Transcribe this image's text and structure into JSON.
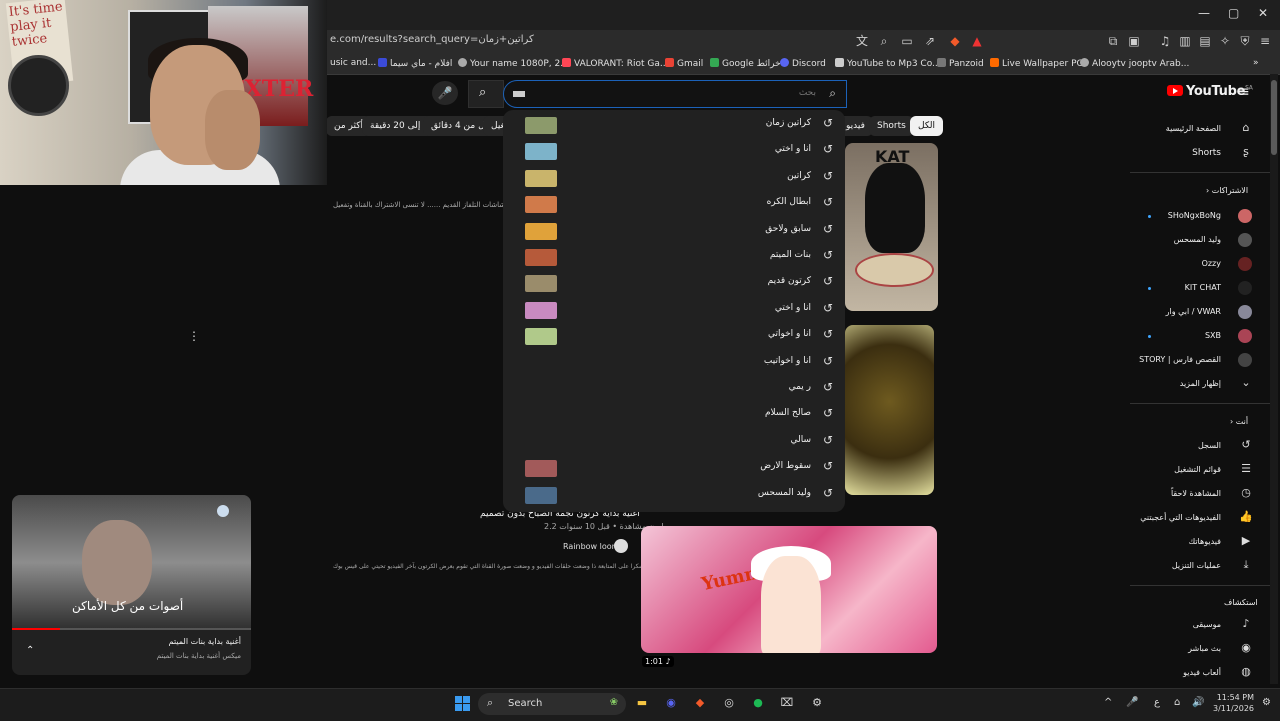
{
  "browser": {
    "url": "e.com/results?search_query=كراتين+زمان",
    "bookmarks": [
      {
        "label": "usic and...",
        "color": "#888888"
      },
      {
        "label": "افلام - ماي سيما",
        "color": "#3b4bd8"
      },
      {
        "label": "Your name 1080P, 2...",
        "color": "#aaaaaa"
      },
      {
        "label": "VALORANT: Riot Ga...",
        "color": "#ff4655"
      },
      {
        "label": "Gmail",
        "color": "#ea4335"
      },
      {
        "label": "Google خرائط",
        "color": "#34a853"
      },
      {
        "label": "Discord",
        "color": "#5865f2"
      },
      {
        "label": "YouTube to Mp3 Co...",
        "color": "#cccccc"
      },
      {
        "label": "Panzoid",
        "color": "#777777"
      },
      {
        "label": "Live Wallpaper PC",
        "color": "#ff6a00"
      },
      {
        "label": "Alooytv jooptv Arab...",
        "color": "#aaaaaa"
      }
    ]
  },
  "header": {
    "logo": "YouTube",
    "logo_region": "SA",
    "search_placeholder": "بحث"
  },
  "chips": [
    {
      "label": "الكل",
      "active": true
    },
    {
      "label": "Shorts",
      "active": false
    },
    {
      "label": "فيديو",
      "active": false
    },
    {
      "label": "تشغيل",
      "active": false
    },
    {
      "label": "أقل من 4 دقائق",
      "active": false
    },
    {
      "label": "من 4 إلى 20 دقيقة",
      "active": false
    },
    {
      "label": "أكثر من",
      "active": false
    }
  ],
  "suggestions": [
    {
      "text": "كراتين زمان",
      "thumb": "#8c9a6b"
    },
    {
      "text": "انا و اختي",
      "thumb": "#7db3c9"
    },
    {
      "text": "كراتين",
      "thumb": "#c9b46b"
    },
    {
      "text": "ابطال الكره",
      "thumb": "#d07a4a"
    },
    {
      "text": "سابق ولاحق",
      "thumb": "#e0a23a"
    },
    {
      "text": "بنات الميتم",
      "thumb": "#b65a3a"
    },
    {
      "text": "كرتون قديم",
      "thumb": "#9a8c6b"
    },
    {
      "text": "انا و اختي",
      "thumb": "#c98ac0"
    },
    {
      "text": "انا و اخواتي",
      "thumb": "#b0c98a"
    },
    {
      "text": "انا و اخواتيب",
      "thumb": ""
    },
    {
      "text": "ر يمي",
      "thumb": ""
    },
    {
      "text": "صالح السلام",
      "thumb": ""
    },
    {
      "text": "سالي",
      "thumb": ""
    },
    {
      "text": "سقوط الارض",
      "thumb": "#a25a5a"
    },
    {
      "text": "وليد المسحس",
      "thumb": "#4a6a8a"
    }
  ],
  "results": {
    "desc1": "على شاشات التلفاز القديم ...... لا تنسى الاشتراك بالقناة وتفعيل",
    "video_title": "أغنية بداية كرتون نجمة الصباح بدون تصميم",
    "video_meta": "2.2 مليون مشاهدة • قبل 10 سنوات",
    "channel": "Rainbow loom",
    "desc2": "شكرا على المتابعة ذا وضعت حلقات الفيديو و وضعت صورة القناة التي تقوم بعرض الكرتون بآخر الفيديو تحيتي على قيس بوك",
    "duration": "1:01"
  },
  "miniplayer": {
    "caption": "أصوات من كل الأماكن",
    "title": "أغنية بداية بنات الميتم",
    "subtitle": "ميكس أغنية بداية بنات الميتم"
  },
  "sidebar": {
    "home": "الصفحة الرئيسية",
    "shorts": "Shorts",
    "subscriptions_header": "الاشتراكات",
    "subscriptions": [
      {
        "name": "SHoNgxBoNg",
        "color": "#c66",
        "dot": true
      },
      {
        "name": "وليد المسحس",
        "color": "#555",
        "dot": false
      },
      {
        "name": "Ozzy",
        "color": "#622",
        "dot": false
      },
      {
        "name": "KIT CHAT",
        "color": "#222",
        "dot": true
      },
      {
        "name": "ابي وار / VWAR",
        "color": "#889",
        "dot": false
      },
      {
        "name": "SXB",
        "color": "#a45",
        "dot": true
      },
      {
        "name": "STORY | القصص فارس",
        "color": "#444",
        "dot": false
      }
    ],
    "show_more": "إظهار المزيد",
    "you_header": "أنت",
    "you_items": [
      "السجل",
      "قوائم التشغيل",
      "المشاهدة لاحقاً",
      "الفيديوهات التي أعجبتني",
      "فيديوهاتك",
      "عمليات التنزيل"
    ],
    "explore_header": "استكشاف",
    "explore_items": [
      "موسيقى",
      "بث مباشر",
      "ألعاب فيديو"
    ]
  },
  "taskbar": {
    "search": "Search",
    "time": "11:54 PM",
    "date": "3/11/2026",
    "lang": "ع"
  }
}
